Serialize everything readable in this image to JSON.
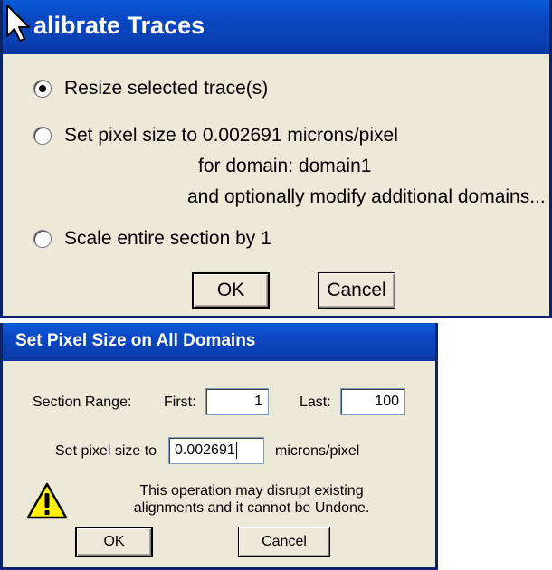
{
  "dialog1": {
    "title": "Calibrate Traces",
    "title_visible": "alibrate Traces",
    "options": [
      {
        "label": "Resize selected trace(s)",
        "checked": true
      },
      {
        "label": "Set pixel size to 0.002691 microns/pixel",
        "checked": false
      },
      {
        "label": "Scale entire section by 1",
        "checked": false
      }
    ],
    "option2_line2": "for domain: domain1",
    "option2_line3": "and optionally modify additional domains...",
    "ok_label": "OK",
    "cancel_label": "Cancel"
  },
  "dialog2": {
    "title": "Set Pixel Size on All Domains",
    "section_range_label": "Section Range:",
    "first_label": "First:",
    "first_value": "1",
    "last_label": "Last:",
    "last_value": "100",
    "pixel_size_label": "Set pixel size to",
    "pixel_size_value": "0.002691",
    "units_label": "microns/pixel",
    "warning_line1": "This operation may disrupt existing",
    "warning_line2": "alignments and it cannot be Undone.",
    "ok_label": "OK",
    "cancel_label": "Cancel",
    "warning_icon": "warning-icon"
  },
  "colors": {
    "titlebar": "#0A49C4",
    "dialog_bg": "#ECE9D8",
    "warning_yellow": "#FFF200"
  }
}
